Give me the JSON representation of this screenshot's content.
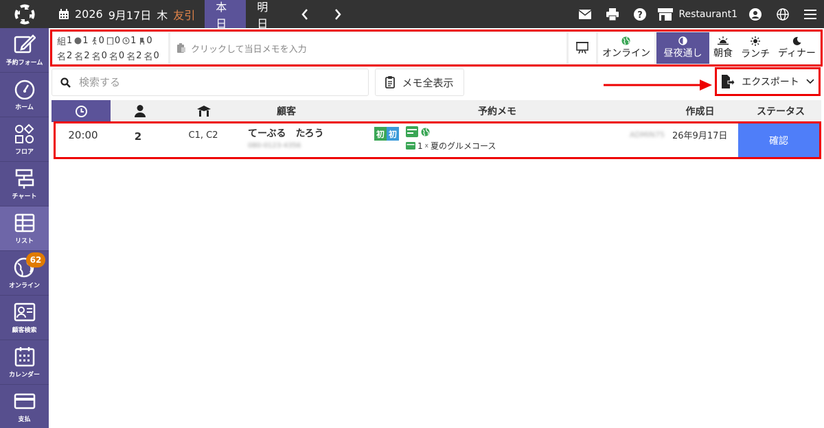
{
  "topbar": {
    "year": "2026",
    "date": "9月17日",
    "weekday": "木",
    "rokuyo": "友引",
    "tab_today": "本日",
    "tab_tomorrow": "明日",
    "restaurant": "Restaurant1"
  },
  "sidebar": {
    "items": [
      {
        "label": "予約フォーム",
        "icon": "edit-icon"
      },
      {
        "label": "ホーム",
        "icon": "gauge-icon"
      },
      {
        "label": "フロア",
        "icon": "floor-icon"
      },
      {
        "label": "チャート",
        "icon": "chart-icon"
      },
      {
        "label": "リスト",
        "icon": "table-icon"
      },
      {
        "label": "オンライン",
        "icon": "globe-icon",
        "badge": "62"
      },
      {
        "label": "顧客検索",
        "icon": "contact-card-icon"
      },
      {
        "label": "カレンダー",
        "icon": "calendar-icon"
      },
      {
        "label": "支払",
        "icon": "credit-card-icon"
      }
    ]
  },
  "summary": {
    "row1": {
      "prefix": "組",
      "c1": "1",
      "c2": "1",
      "c3": "0",
      "c4": "0",
      "c5": "1",
      "c6": "0"
    },
    "row2": {
      "prefix": "名",
      "c1": "2",
      "c1s": "名",
      "c2": "2",
      "c2s": "名",
      "c3": "0",
      "c3s": "名",
      "c4": "0",
      "c4s": "名",
      "c5": "2",
      "c5s": "名",
      "c6": "0"
    },
    "memo_placeholder": "クリックして当日メモを入力",
    "online": "オンライン",
    "meals": {
      "all_day": "昼夜通し",
      "breakfast": "朝食",
      "lunch": "ランチ",
      "dinner": "ディナー"
    }
  },
  "search": {
    "placeholder": "検索する"
  },
  "memo_all": "メモ全表示",
  "export": "エクスポート",
  "table": {
    "headers": {
      "customer": "顧客",
      "memo": "予約メモ",
      "created": "作成日",
      "status": "ステータス"
    },
    "rows": [
      {
        "time": "20:00",
        "guests": "2",
        "tables": "C1, C2",
        "name": "てーぶる　たろう",
        "phone": "080-0123-4356",
        "tag1": "初",
        "tag2": "初",
        "course_qty": "1",
        "course_x": "x",
        "course_name": "夏のグルメコース",
        "creator": "ADMIN75",
        "created": "26年9月17日",
        "status": "確認"
      }
    ]
  },
  "colors": {
    "accent": "#5b5399",
    "sidebar": "#574f8e",
    "status": "#4f7ef9",
    "badge": "#e07b00",
    "highlight": "#ee0000",
    "online_green": "#3aa655"
  }
}
